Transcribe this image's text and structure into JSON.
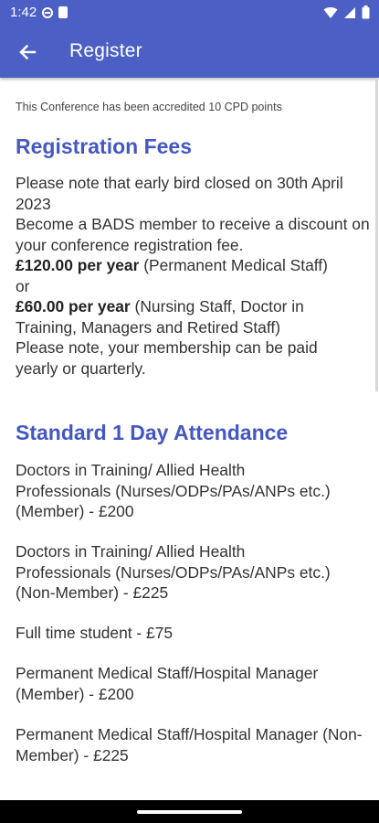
{
  "status_bar": {
    "time": "1:42",
    "icons": [
      "vpn-icon",
      "sim-card-icon",
      "wifi-icon",
      "signal-icon",
      "battery-icon"
    ]
  },
  "app_bar": {
    "title": "Register",
    "back_icon": "arrow-left-icon",
    "background_color": "#4c5fc4"
  },
  "content": {
    "accreditation": "This Conference has been accredited 10 CPD points",
    "registration_fees": {
      "heading": "Registration Fees",
      "early_bird": "Please note that early bird closed on 30th April 2023",
      "member_intro": "Become a BADS member to receive a discount on your conference registration fee.",
      "price_permanent": "£120.00 per year",
      "price_permanent_desc": "(Permanent Medical Staff)",
      "or": "or",
      "price_other": "£60.00 per year",
      "price_other_desc": "(Nursing Staff, Doctor in Training, Managers and Retired Staff)",
      "payment_note": "Please note, your membership can be paid yearly or quarterly."
    },
    "standard_attendance": {
      "heading": "Standard 1 Day Attendance",
      "items": [
        "Doctors in Training/ Allied Health Professionals (Nurses/ODPs/PAs/ANPs etc.) (Member) - £200",
        "Doctors in Training/ Allied Health Professionals (Nurses/ODPs/PAs/ANPs etc.) (Non-Member) - £225",
        "Full time student - £75",
        "Permanent Medical Staff/Hospital Manager (Member) - £200",
        "Permanent Medical Staff/Hospital Manager (Non-Member) - £225"
      ]
    },
    "heading_color": "#4458c2"
  }
}
